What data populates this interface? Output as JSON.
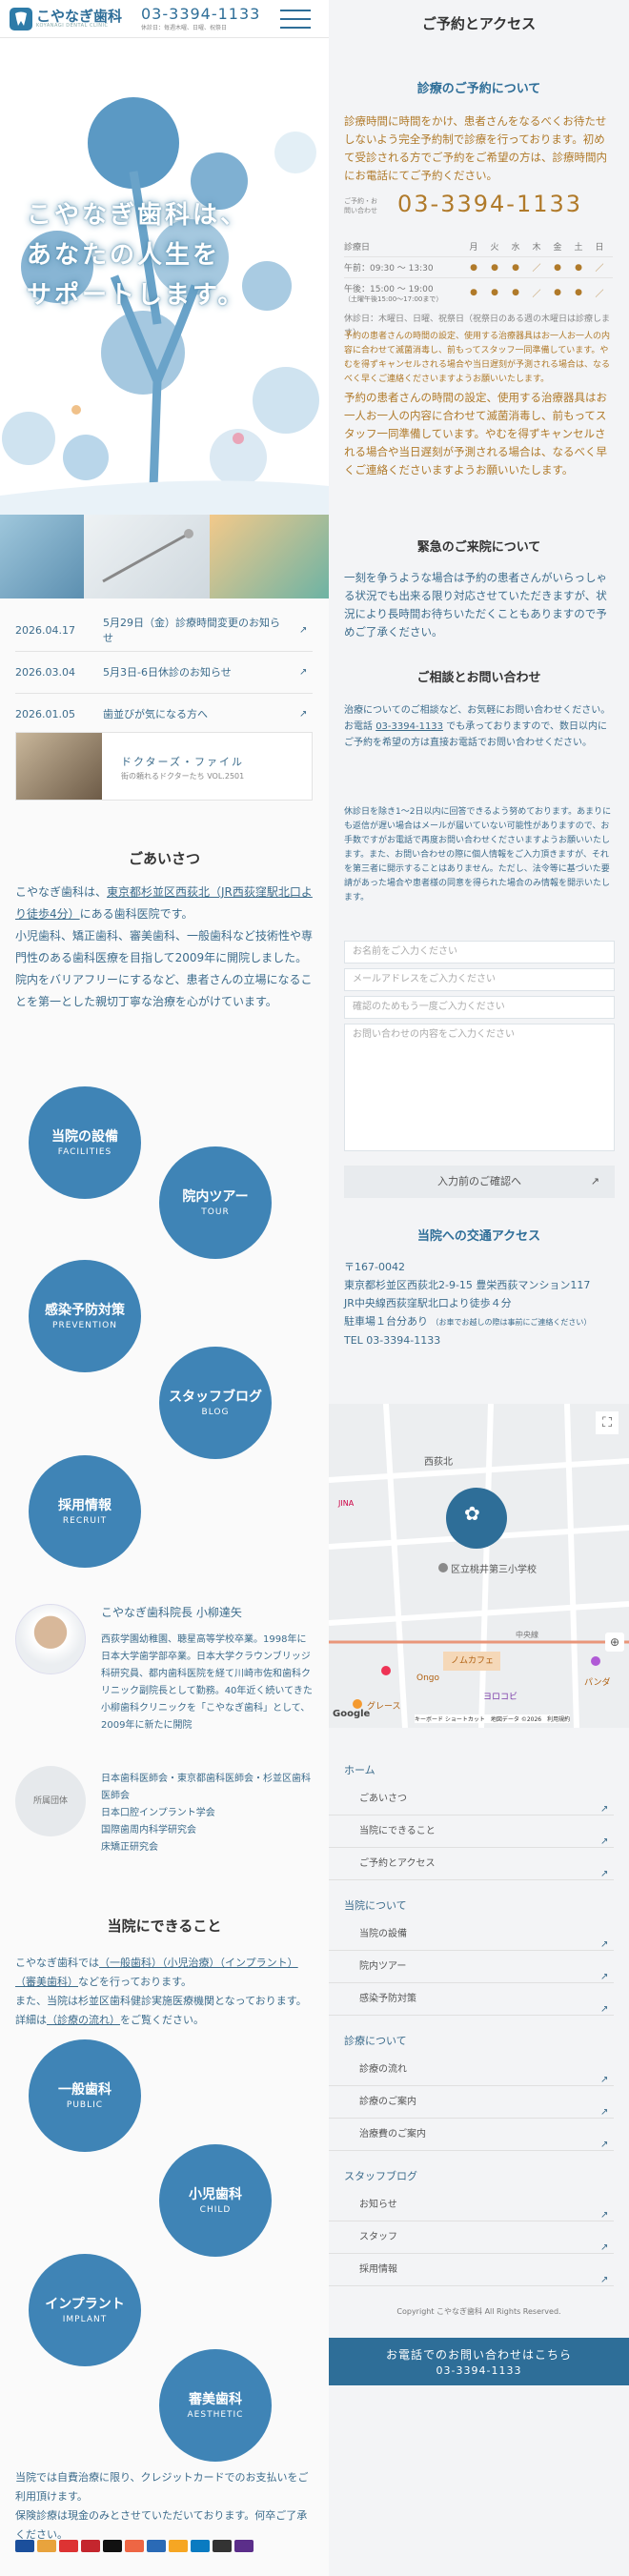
{
  "header": {
    "logo_name": "こやなぎ歯科",
    "logo_sub": "KOYANAGI DENTAL CLINIC",
    "tel": "03-3394-1133",
    "hours": "休診日：毎週木曜、日曜、祝祭日"
  },
  "hero": {
    "line1": "こやなぎ歯科は、",
    "line2": "あなたの人生を",
    "line3": "サポートします。"
  },
  "news": [
    {
      "date": "2026.04.17",
      "title": "5月29日（金）診療時間変更のお知らせ"
    },
    {
      "date": "2026.03.04",
      "title": "5月3日-6日休診のお知らせ"
    },
    {
      "date": "2026.01.05",
      "title": "歯並びが気になる方へ"
    }
  ],
  "doctor_file": {
    "title": "ドクターズ・ファイル",
    "sub": "街の頼れるドクターたち VOL.2501"
  },
  "greeting": {
    "heading": "ごあいさつ",
    "p1a": "こやなぎ歯科は、",
    "p1link": "東京都杉並区西荻北（JR西荻窪駅北口より徒歩4分）",
    "p1b": "にある歯科医院です。",
    "p2": "小児歯科、矯正歯科、審美歯科、一般歯科など技術性や専門性のある歯科医療を目指して2009年に開院しました。",
    "p3": "院内をバリアフリーにするなど、患者さんの立場になることを第一とした親切丁寧な治療を心がけています。"
  },
  "circles1": [
    {
      "ja": "当院の設備",
      "en": "FACILITIES"
    },
    {
      "ja": "院内ツアー",
      "en": "TOUR"
    },
    {
      "ja": "感染予防対策",
      "en": "PREVENTION"
    },
    {
      "ja": "スタッフブログ",
      "en": "BLOG"
    },
    {
      "ja": "採用情報",
      "en": "RECRUIT"
    }
  ],
  "director": {
    "title": "こやなぎ歯科院長 小柳達矢",
    "bio": "西荻学園幼稚園、聴星高等学校卒業。1998年に日本大学歯学部卒業。日本大学クラウンブリッジ科研究員、都内歯科医院を経て川崎市佐和歯科クリニック副院長として勤務。40年近く続いてきた小柳歯科クリニックを「こやなぎ歯科」として、2009年に新たに開院",
    "badge": "所属団体",
    "orgs": [
      "日本歯科医師会・東京都歯科医師会・杉並区歯科医師会",
      "日本口腔インプラント学会",
      "国際歯周内科学研究会",
      "床矯正研究会"
    ]
  },
  "services": {
    "heading": "当院にできること",
    "p1a": "こやなぎ歯科では",
    "p1link": "（一般歯科）（小児治療）（インプラント）（審美歯科）",
    "p1b": "などを行っております。",
    "p2a": "また、当院は杉並区歯科健診実施医療機関となっております。詳細は",
    "p2link": "（診療の流れ）",
    "p2b": "をご覧ください。",
    "p3": "当院では自費治療に限り、クレジットカードでのお支払いをご利用頂けます。",
    "p4": "保険診療は現金のみとさせていただいております。何卒ご了承ください。"
  },
  "circles2": [
    {
      "ja": "一般歯科",
      "en": "PUBLIC"
    },
    {
      "ja": "小児歯科",
      "en": "CHILD"
    },
    {
      "ja": "インプラント",
      "en": "IMPLANT"
    },
    {
      "ja": "審美歯科",
      "en": "AESTHETIC"
    }
  ],
  "reserve": {
    "heading": "ご予約とアクセス",
    "sub": "診療のご予約について",
    "p1": "診療時間に時間をかけ、患者さんをなるべくお待たせしないよう完全予約制で診療を行っております。初めて受診される方でご予約をご希望の方は、診療時間内にお電話にてご予約ください。",
    "tel_label": "ご予約・お問い合わせ",
    "tel": "03-3394-1133",
    "sched_head": [
      "診療日",
      "月",
      "火",
      "水",
      "木",
      "金",
      "土",
      "日"
    ],
    "am_label": "午前：09:30 ～ 13:30",
    "pm_label": "午後：15:00 ～ 19:00",
    "pm_note": "（土曜午後15:00～17:00まで）",
    "am_marks": [
      "●",
      "●",
      "●",
      "／",
      "●",
      "●",
      "／"
    ],
    "pm_marks": [
      "●",
      "●",
      "●",
      "／",
      "●",
      "●",
      "／"
    ],
    "holiday": "休診日：木曜日、日曜、祝祭日（祝祭日のある週の木曜日は診療します）",
    "note1": "予約の患者さんの時間の設定、使用する治療器具はお一人お一人の内容に合わせて滅菌消毒し、前もってスタッフ一同準備しています。やむを得ずキャンセルされる場合や当日遅刻が予測される場合は、なるべく早くご連絡くださいますようお願いいたします。",
    "note2": "予約の患者さんの時間の設定、使用する治療器具はお一人お一人の内容に合わせて滅菌消毒し、前もってスタッフ一同準備しています。やむを得ずキャンセルされる場合や当日遅刻が予測される場合は、なるべく早くご連絡くださいますようお願いいたします。"
  },
  "emergency": {
    "heading": "緊急のご来院について",
    "text": "一刻を争うような場合は予約の患者さんがいらっしゃる状況でも出来る限り対応させていただきますが、状況により長時間お待ちいただくこともありますので予めご了承ください。"
  },
  "inquiry": {
    "heading": "ご相談とお問い合わせ",
    "t1": "治療についてのご相談など、お気軽にお問い合わせください。",
    "t2a": "お電話",
    "t2tel": "03-3394-1133",
    "t2b": "でも承っておりますので、数日以内にご予約を希望の方は直接お電話でお問い合わせください。",
    "t3": "休診日を除き1～2日以内に回答できるよう努めております。あまりにも返信が遅い場合はメールが届いていない可能性がありますので、お手数ですがお電話で再度お問い合わせくださいますようお願いいたします。また、お問い合わせの際に個人情報をご入力頂きますが、それを第三者に開示することはありません。ただし、法令等に基づいた要請があった場合や患者様の同意を得られた場合のみ情報を開示いたします。",
    "ph_name": "お名前をご入力ください",
    "ph_email": "メールアドレスをご入力ください",
    "ph_email2": "確認のためもう一度ご入力ください",
    "ph_body": "お問い合わせの内容をご入力ください",
    "confirm": "入力前のご確認へ"
  },
  "access": {
    "heading": "当院への交通アクセス",
    "zip": "〒167-0042",
    "addr": "東京都杉並区西荻北2-9-15 豊栄西荻マンション117",
    "station": "JR中央線西荻窪駅北口より徒歩４分",
    "parking": "駐車場１台分あり",
    "parking_note": "（お車でお越しの際は事前にご連絡ください）",
    "tel": "TEL 03-3394-1133"
  },
  "map": {
    "labels": [
      "西荻北",
      "区立桃井第三小学校",
      "中央線",
      "ノムカフェ",
      "ヨロコビ",
      "パンダ",
      "グレース",
      "Ongo",
      "JINA"
    ],
    "credit": "キーボード ショートカット　地図データ ©2026　利用規約"
  },
  "footnav": [
    {
      "head": "ホーム",
      "items": [
        "ごあいさつ",
        "当院にできること",
        "ご予約とアクセス"
      ]
    },
    {
      "head": "当院について",
      "items": [
        "当院の設備",
        "院内ツアー",
        "感染予防対策"
      ]
    },
    {
      "head": "診療について",
      "items": [
        "診療の流れ",
        "診療のご案内",
        "治療費のご案内"
      ]
    },
    {
      "head": "スタッフブログ",
      "items": [
        "お知らせ",
        "スタッフ",
        "採用情報"
      ]
    }
  ],
  "copyright": "Copyright こやなぎ歯科 All Rights Reserved.",
  "cta": {
    "line1": "お電話でのお問い合わせはこちら",
    "line2": "03-3394-1133"
  },
  "colors": {
    "primary": "#2e6e98",
    "circle": "#3f84b6",
    "accent": "#b07a2a"
  }
}
